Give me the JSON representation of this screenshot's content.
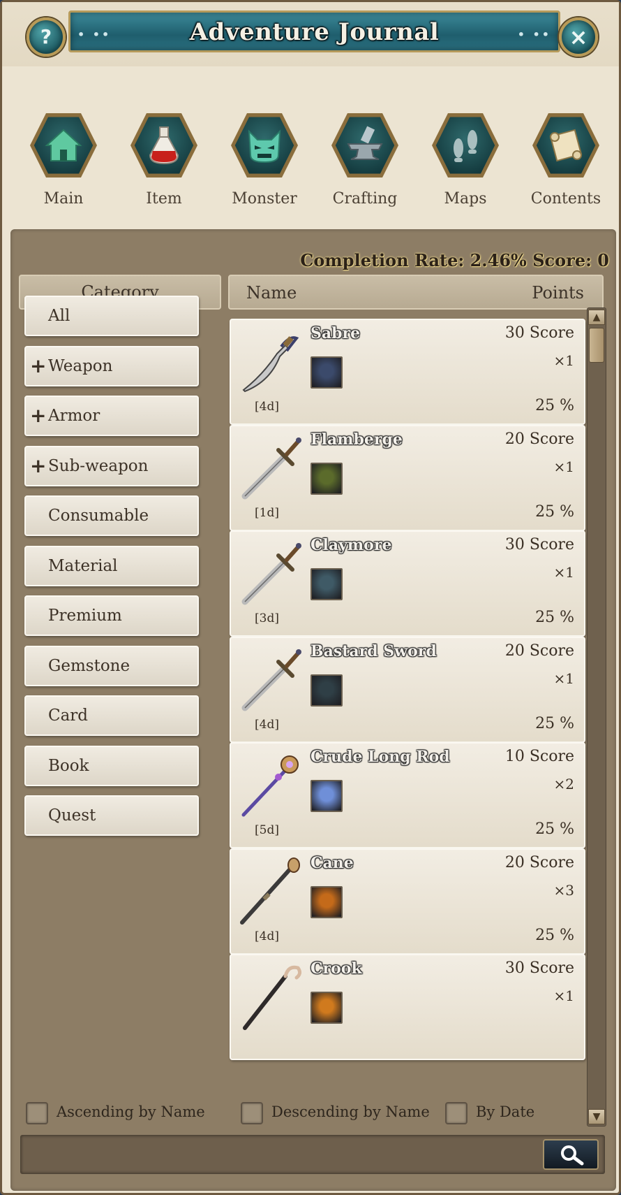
{
  "window": {
    "title": "Adventure Journal",
    "title_dots_left": "• ••",
    "title_dots_right": "• ••",
    "help_label": "?",
    "close_label": "×"
  },
  "nav": [
    {
      "label": "Main",
      "icon": "house-icon"
    },
    {
      "label": "Item",
      "icon": "potion-icon"
    },
    {
      "label": "Monster",
      "icon": "monster-icon"
    },
    {
      "label": "Crafting",
      "icon": "anvil-icon"
    },
    {
      "label": "Maps",
      "icon": "footprints-icon"
    },
    {
      "label": "Contents",
      "icon": "scroll-icon"
    }
  ],
  "stats": {
    "completion_text": "Completion Rate: 2.46%  Score: 0"
  },
  "headers": {
    "category": "Category",
    "name": "Name",
    "points": "Points"
  },
  "categories": [
    {
      "label": "All",
      "expandable": false
    },
    {
      "label": "Weapon",
      "expandable": true
    },
    {
      "label": "Armor",
      "expandable": true
    },
    {
      "label": "Sub-weapon",
      "expandable": true
    },
    {
      "label": "Consumable",
      "expandable": false
    },
    {
      "label": "Material",
      "expandable": false
    },
    {
      "label": "Premium",
      "expandable": false
    },
    {
      "label": "Gemstone",
      "expandable": false
    },
    {
      "label": "Card",
      "expandable": false
    },
    {
      "label": "Book",
      "expandable": false
    },
    {
      "label": "Quest",
      "expandable": false
    }
  ],
  "plus_glyph": "+",
  "items": [
    {
      "name": "Sabre",
      "score": "30 Score",
      "qty": "×1",
      "time": "[4d]",
      "pct": "25 %",
      "weapon": "sabre",
      "monster_color": "#3b4a6b"
    },
    {
      "name": "Flamberge",
      "score": "20 Score",
      "qty": "×1",
      "time": "[1d]",
      "pct": "25 %",
      "weapon": "sword",
      "monster_color": "#5b6b2b"
    },
    {
      "name": "Claymore",
      "score": "30 Score",
      "qty": "×1",
      "time": "[3d]",
      "pct": "25 %",
      "weapon": "sword",
      "monster_color": "#3f5a66"
    },
    {
      "name": "Bastard Sword",
      "score": "20 Score",
      "qty": "×1",
      "time": "[4d]",
      "pct": "25 %",
      "weapon": "sword",
      "monster_color": "#2f3f46"
    },
    {
      "name": "Crude Long Rod",
      "score": "10 Score",
      "qty": "×2",
      "time": "[5d]",
      "pct": "25 %",
      "weapon": "rod",
      "monster_color": "#6f8fd8"
    },
    {
      "name": "Cane",
      "score": "20 Score",
      "qty": "×3",
      "time": "[4d]",
      "pct": "25 %",
      "weapon": "staff",
      "monster_color": "#c46a1a"
    },
    {
      "name": "Crook",
      "score": "30 Score",
      "qty": "×1",
      "time": "",
      "pct": "",
      "weapon": "crook",
      "monster_color": "#d07a1e"
    }
  ],
  "sort": [
    {
      "label": "Ascending by Name"
    },
    {
      "label": "Descending by Name"
    },
    {
      "label": "By Date"
    }
  ],
  "search": {
    "placeholder": "",
    "value": ""
  },
  "scroll": {
    "up": "▲",
    "down": "▼"
  }
}
